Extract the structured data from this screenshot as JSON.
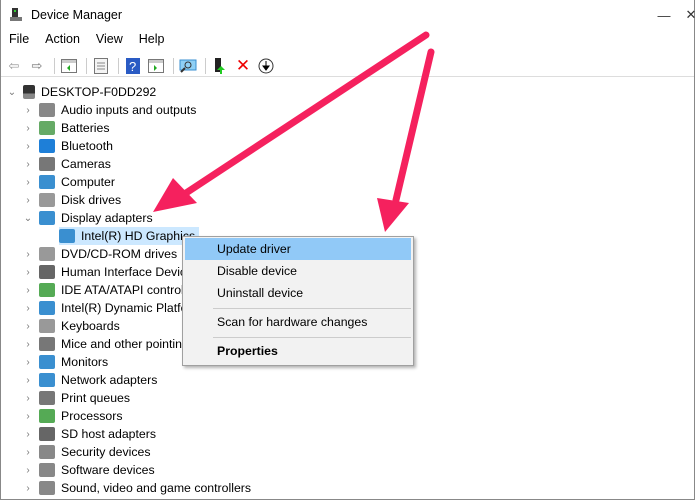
{
  "window": {
    "title": "Device Manager",
    "minimize": "—",
    "close": "✕"
  },
  "menu": [
    "File",
    "Action",
    "View",
    "Help"
  ],
  "toolbar": [
    "back",
    "forward",
    "show-hide-console-tree",
    "properties",
    "help",
    "run",
    "scan-hardware",
    "update-driver",
    "uninstall",
    "disable"
  ],
  "tree": {
    "root": "DESKTOP-F0DD292",
    "items": [
      {
        "label": "Audio inputs and outputs",
        "icon": "speaker-icon",
        "color": "#888"
      },
      {
        "label": "Batteries",
        "icon": "battery-icon",
        "color": "#6a6"
      },
      {
        "label": "Bluetooth",
        "icon": "bluetooth-icon",
        "color": "#1e7fd8"
      },
      {
        "label": "Cameras",
        "icon": "camera-icon",
        "color": "#777"
      },
      {
        "label": "Computer",
        "icon": "computer-icon",
        "color": "#3a8fd0"
      },
      {
        "label": "Disk drives",
        "icon": "disk-icon",
        "color": "#999"
      },
      {
        "label": "Display adapters",
        "icon": "display-adapter-icon",
        "color": "#3a8fd0",
        "expanded": true
      },
      {
        "label": "Intel(R) HD Graphics",
        "icon": "display-adapter-icon",
        "color": "#3a8fd0",
        "child": true,
        "shown": "Intel(R) HD Graphic"
      },
      {
        "label": "DVD/CD-ROM drives",
        "icon": "dvd-icon",
        "color": "#999"
      },
      {
        "label": "Human Interface Devic",
        "icon": "hid-icon",
        "color": "#666"
      },
      {
        "label": "IDE ATA/ATAPI control",
        "icon": "ide-icon",
        "color": "#5a5"
      },
      {
        "label": "Intel(R) Dynamic Platfo",
        "icon": "platform-icon",
        "color": "#3a8fd0"
      },
      {
        "label": "Keyboards",
        "icon": "keyboard-icon",
        "color": "#999"
      },
      {
        "label": "Mice and other pointin",
        "icon": "mouse-icon",
        "color": "#777"
      },
      {
        "label": "Monitors",
        "icon": "monitor-icon",
        "color": "#3a8fd0"
      },
      {
        "label": "Network adapters",
        "icon": "network-icon",
        "color": "#3a8fd0"
      },
      {
        "label": "Print queues",
        "icon": "printer-icon",
        "color": "#777"
      },
      {
        "label": "Processors",
        "icon": "processor-icon",
        "color": "#5a5"
      },
      {
        "label": "SD host adapters",
        "icon": "sd-icon",
        "color": "#666"
      },
      {
        "label": "Security devices",
        "icon": "security-icon",
        "color": "#888"
      },
      {
        "label": "Software devices",
        "icon": "software-icon",
        "color": "#888"
      },
      {
        "label": "Sound, video and game controllers",
        "icon": "sound-icon",
        "color": "#888"
      }
    ]
  },
  "context_menu": {
    "items": [
      "Update driver",
      "Disable device",
      "Uninstall device",
      "Scan for hardware changes",
      "Properties"
    ]
  },
  "colors": {
    "arrow": "#f5215e",
    "highlight": "#91c9f7",
    "selection": "#cce8ff"
  }
}
